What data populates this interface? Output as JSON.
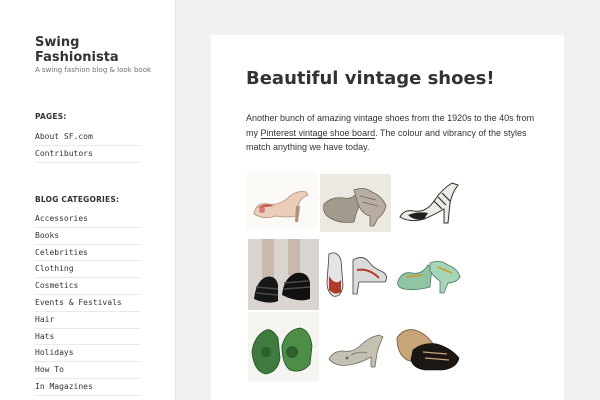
{
  "site": {
    "title": "Swing Fashionista",
    "description": "A swing fashion blog & look book"
  },
  "pages_widget": {
    "title": "PAGES:",
    "items": [
      "About SF.com",
      "Contributors"
    ]
  },
  "categories_widget": {
    "title": "BLOG CATEGORIES:",
    "items": [
      "Accessories",
      "Books",
      "Celebrities",
      "Clothing",
      "Cosmetics",
      "Events & Festivals",
      "Hair",
      "Hats",
      "Holidays",
      "How To",
      "In Magazines"
    ]
  },
  "post": {
    "title": "Beautiful vintage shoes!",
    "text_before": "Another bunch of amazing vintage shoes from the 1920s to the 40s from my ",
    "link_text": "Pinterest vintage shoe board",
    "text_after": ". The colour and vibrancy of the styles match anything we have today."
  },
  "colors": {
    "page_bg": "#f1f1f1",
    "panel_bg": "#ffffff",
    "text": "#333333",
    "muted": "#707070"
  }
}
